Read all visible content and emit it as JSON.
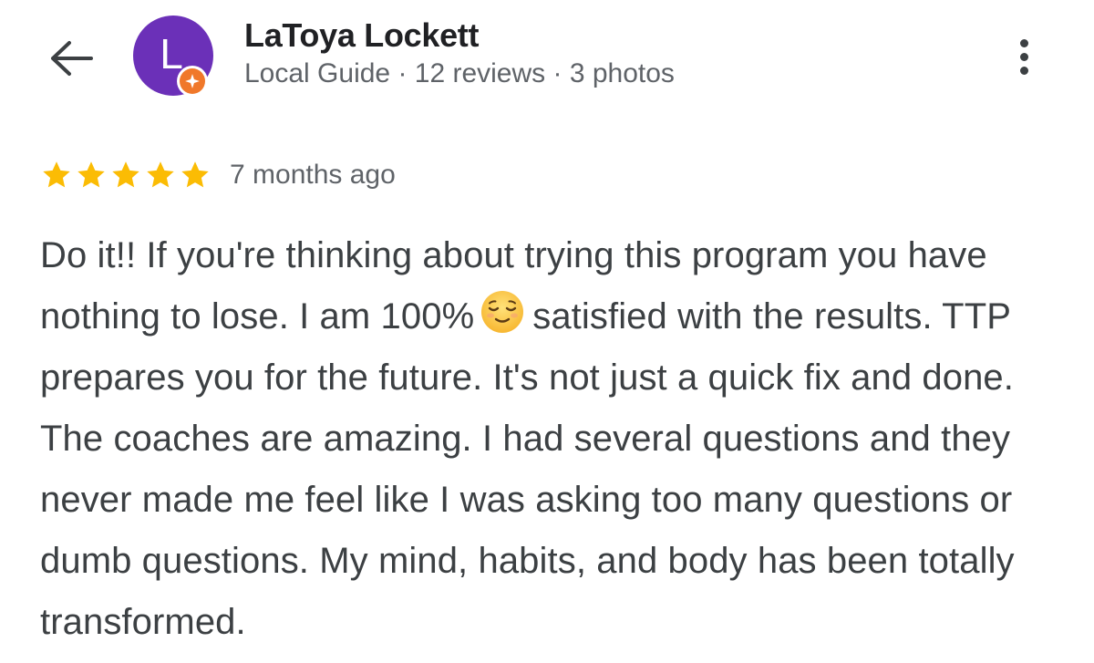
{
  "reviewer": {
    "avatar_letter": "L",
    "avatar_color": "#6b30b8",
    "badge_color": "#f0782a",
    "name": "LaToya Lockett",
    "meta": "Local Guide · 12 reviews · 3 photos"
  },
  "review": {
    "rating": 5,
    "max_rating": 5,
    "star_color": "#fbbc04",
    "time": "7 months ago",
    "text_before_emoji": "Do it!! If you're thinking about trying this program you have nothing to lose. I am 100%",
    "emoji": "relieved-face-emoji",
    "text_after_emoji": "satisfied with the results. TTP prepares you for the future. It's not just a quick fix and done. The coaches are amazing. I had several questions and they never made me feel like I was asking too many questions or dumb questions. My mind, habits, and body has been totally transformed."
  },
  "icons": {
    "back": "arrow-back-icon",
    "more": "more-vert-icon",
    "local_guide_badge": "local-guide-star-icon",
    "star": "star-icon"
  }
}
